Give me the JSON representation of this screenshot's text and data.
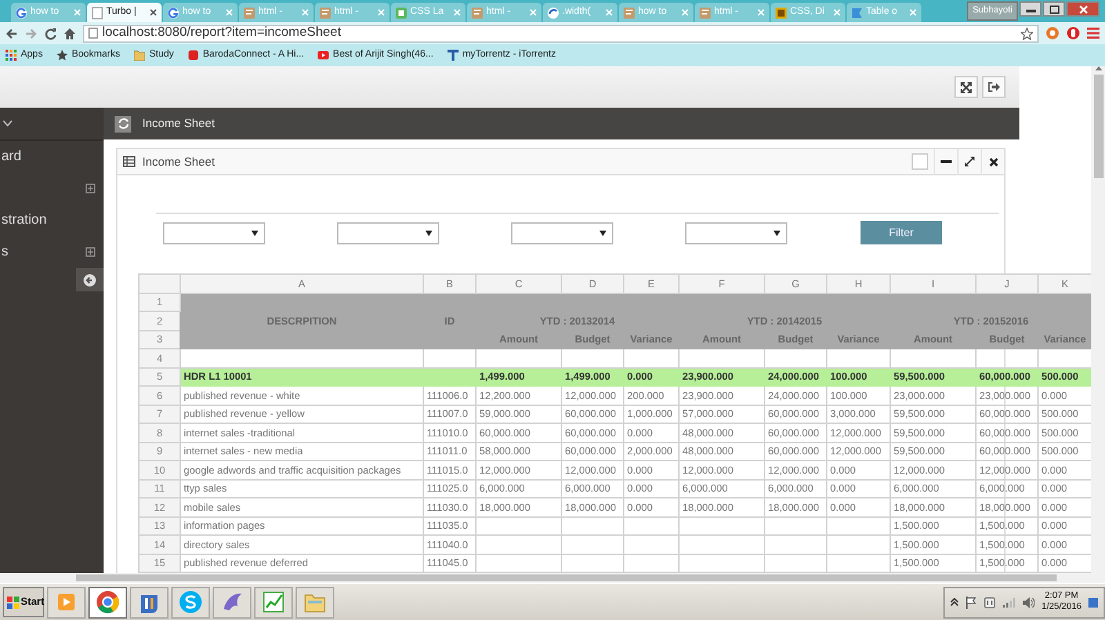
{
  "browser": {
    "tabs": [
      {
        "label": "how to",
        "kind": "google",
        "selected": false
      },
      {
        "label": "Turbo |",
        "kind": "blank",
        "selected": true
      },
      {
        "label": "how to",
        "kind": "google",
        "selected": false
      },
      {
        "label": "html - ",
        "kind": "page",
        "selected": false
      },
      {
        "label": "html - ",
        "kind": "page",
        "selected": false
      },
      {
        "label": "CSS La",
        "kind": "css",
        "selected": false
      },
      {
        "label": "html - ",
        "kind": "page",
        "selected": false
      },
      {
        "label": ".width(",
        "kind": "swirl",
        "selected": false
      },
      {
        "label": "how to",
        "kind": "page",
        "selected": false
      },
      {
        "label": "html - ",
        "kind": "page",
        "selected": false
      },
      {
        "label": "CSS, Di",
        "kind": "square",
        "selected": false
      },
      {
        "label": "Table o",
        "kind": "flag",
        "selected": false
      }
    ],
    "user": "Subhayoti",
    "address": "localhost:8080/report?item=incomeSheet",
    "bookmarks": [
      {
        "label": "Apps",
        "kind": "grid"
      },
      {
        "label": "Bookmarks",
        "kind": "star"
      },
      {
        "label": "Study",
        "kind": "folder"
      },
      {
        "label": "BarodaConnect - A Hi...",
        "kind": "red"
      },
      {
        "label": "Best of Arijit Singh(46...",
        "kind": "play"
      },
      {
        "label": "myTorrentz - iTorrentz",
        "kind": "torrent"
      }
    ]
  },
  "sidebar": {
    "items": [
      {
        "label": "ard",
        "expandable": false
      },
      {
        "expandable": true
      },
      {
        "label": "stration",
        "expandable": false
      },
      {
        "label": "s",
        "expandable": true
      }
    ]
  },
  "title_bar": {
    "title": "Income Sheet"
  },
  "panel": {
    "title": "Income Sheet",
    "select_box": {
      "checked": false
    },
    "filters": [
      {
        "kind": "select"
      },
      {
        "kind": "select"
      },
      {
        "kind": "select"
      },
      {
        "kind": "select"
      }
    ],
    "filter_button": "Filter"
  },
  "sheet": {
    "column_letters": [
      "A",
      "B",
      "C",
      "D",
      "E",
      "F",
      "G",
      "H",
      "I",
      "J",
      "K"
    ],
    "header_row_numbers": [
      "1",
      "2",
      "3"
    ],
    "description_header": "DESCRPITION",
    "id_header": "ID",
    "periods": [
      {
        "label": "YTD : 20132014",
        "columns": [
          "Amount",
          "Budget",
          "Variance"
        ]
      },
      {
        "label": "YTD : 20142015",
        "columns": [
          "Amount",
          "Budget",
          "Variance"
        ]
      },
      {
        "label": "YTD : 20152016",
        "columns": [
          "Amount",
          "Budget",
          "Variance"
        ]
      }
    ],
    "rows": [
      {
        "num": "4",
        "kind": "blank"
      },
      {
        "num": "5",
        "kind": "group",
        "cells": [
          "HDR L1 10001",
          null,
          "1,499.000",
          "1,499.000",
          "0.000",
          "23,900.000",
          "24,000.000",
          "100.000",
          "59,500.000",
          "60,000.000",
          "500.000"
        ]
      },
      {
        "num": "6",
        "kind": "data",
        "cells": [
          "published revenue - white",
          "111006.0",
          "12,200.000",
          "12,000.000",
          "200.000",
          "23,900.000",
          "24,000.000",
          "100.000",
          "23,000.000",
          "23,000.000",
          "0.000"
        ]
      },
      {
        "num": "7",
        "kind": "data",
        "cells": [
          "published revenue - yellow",
          "111007.0",
          "59,000.000",
          "60,000.000",
          "1,000.000",
          "57,000.000",
          "60,000.000",
          "3,000.000",
          "59,500.000",
          "60,000.000",
          "500.000"
        ]
      },
      {
        "num": "8",
        "kind": "data",
        "cells": [
          "internet sales -traditional",
          "111010.0",
          "60,000.000",
          "60,000.000",
          "0.000",
          "48,000.000",
          "60,000.000",
          "12,000.000",
          "59,500.000",
          "60,000.000",
          "500.000"
        ]
      },
      {
        "num": "9",
        "kind": "data",
        "cells": [
          "internet sales - new media",
          "111011.0",
          "58,000.000",
          "60,000.000",
          "2,000.000",
          "48,000.000",
          "60,000.000",
          "12,000.000",
          "59,500.000",
          "60,000.000",
          "500.000"
        ]
      },
      {
        "num": "10",
        "kind": "data",
        "cells": [
          "google adwords and traffic acquisition packages",
          "111015.0",
          "12,000.000",
          "12,000.000",
          "0.000",
          "12,000.000",
          "12,000.000",
          "0.000",
          "12,000.000",
          "12,000.000",
          "0.000"
        ]
      },
      {
        "num": "11",
        "kind": "data",
        "cells": [
          "ttyp sales",
          "111025.0",
          "6,000.000",
          "6,000.000",
          "0.000",
          "6,000.000",
          "6,000.000",
          "0.000",
          "6,000.000",
          "6,000.000",
          "0.000"
        ]
      },
      {
        "num": "12",
        "kind": "data",
        "cells": [
          "mobile sales",
          "111030.0",
          "18,000.000",
          "18,000.000",
          "0.000",
          "18,000.000",
          "18,000.000",
          "0.000",
          "18,000.000",
          "18,000.000",
          "0.000"
        ]
      },
      {
        "num": "13",
        "kind": "data",
        "cells": [
          "information pages",
          "111035.0",
          null,
          null,
          null,
          null,
          null,
          null,
          "1,500.000",
          "1,500.000",
          "0.000"
        ]
      },
      {
        "num": "14",
        "kind": "data",
        "cells": [
          "directory sales",
          "111040.0",
          null,
          null,
          null,
          null,
          null,
          null,
          "1,500.000",
          "1,500.000",
          "0.000"
        ]
      },
      {
        "num": "15",
        "kind": "data",
        "cells": [
          "published revenue deferred",
          "111045.0",
          null,
          null,
          null,
          null,
          null,
          null,
          "1,500.000",
          "1,500.000",
          "0.000"
        ]
      }
    ]
  },
  "taskbar": {
    "start": "Start",
    "apps": [
      {
        "kind": "media",
        "selected": false
      },
      {
        "kind": "chrome",
        "selected": true
      },
      {
        "kind": "ji",
        "selected": false
      },
      {
        "kind": "skype",
        "selected": false
      },
      {
        "kind": "dolphin",
        "selected": false
      },
      {
        "kind": "chart",
        "selected": false
      },
      {
        "kind": "folder",
        "selected": false
      }
    ],
    "time": "2:07 PM",
    "date": "1/25/2016"
  }
}
